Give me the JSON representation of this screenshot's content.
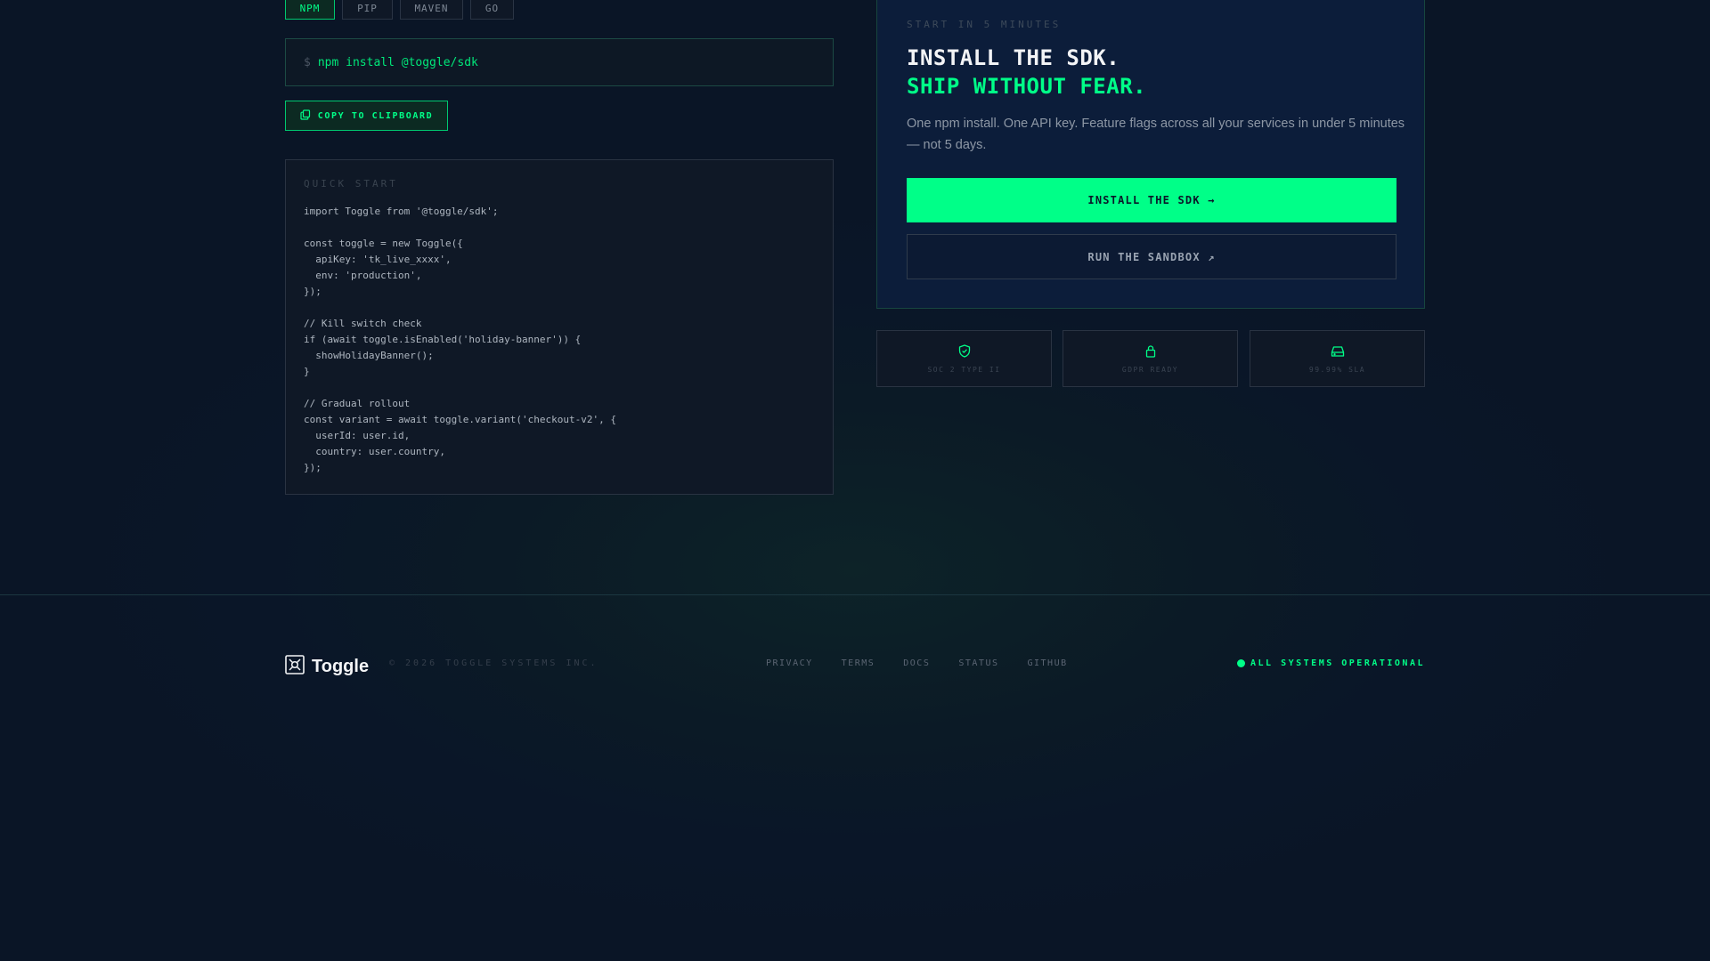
{
  "tabs": [
    {
      "label": "NPM",
      "active": true
    },
    {
      "label": "PIP",
      "active": false
    },
    {
      "label": "MAVEN",
      "active": false
    },
    {
      "label": "GO",
      "active": false
    }
  ],
  "install": {
    "prompt": "$",
    "command": "npm install @toggle/sdk",
    "copy_label": "COPY TO CLIPBOARD"
  },
  "quick_start": {
    "label": "QUICK START",
    "lines": [
      "import Toggle from '@toggle/sdk';",
      "",
      "const toggle = new Toggle({",
      "  apiKey: 'tk_live_xxxx',",
      "  env: 'production',",
      "});",
      "",
      "// Kill switch check",
      "if (await toggle.isEnabled('holiday-banner')) {",
      "  showHolidayBanner();",
      "}",
      "",
      "// Gradual rollout",
      "const variant = await toggle.variant('checkout-v2', {",
      "  userId: user.id,",
      "  country: user.country,",
      "});"
    ]
  },
  "hero": {
    "eyebrow": "START IN 5 MINUTES",
    "headline": "INSTALL THE SDK.",
    "headline_accent": "SHIP WITHOUT FEAR.",
    "description": "One npm install. One API key. Feature flags across all your services in under 5 minutes — not 5 days.",
    "primary_button": "INSTALL THE SDK →",
    "secondary_button": "RUN THE SANDBOX ↗"
  },
  "badges": [
    {
      "icon": "shield-check-icon",
      "label": "SOC 2 TYPE II"
    },
    {
      "icon": "lock-icon",
      "label": "GDPR READY"
    },
    {
      "icon": "server-icon",
      "label": "99.99% SLA"
    }
  ],
  "footer": {
    "brand": "Toggle",
    "copyright": "© 2026 TOGGLE SYSTEMS INC.",
    "links": [
      "PRIVACY",
      "TERMS",
      "DOCS",
      "STATUS",
      "GITHUB"
    ],
    "status": "ALL SYSTEMS OPERATIONAL"
  },
  "colors": {
    "accent": "#00ff88",
    "background": "#0a1628",
    "card": "#0f1826",
    "hero_card": "#0c1d3a"
  }
}
